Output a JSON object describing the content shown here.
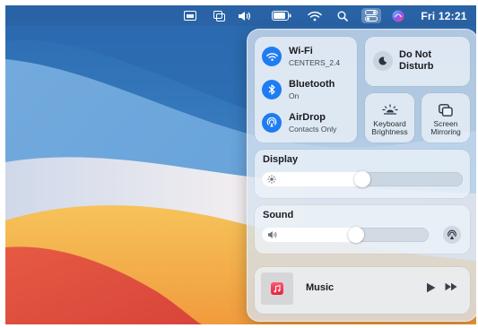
{
  "menubar": {
    "icons": [
      "keyboard-shortcut-icon",
      "mirroring-icon",
      "volume-icon",
      "battery-icon",
      "wifi-icon",
      "search-icon",
      "control-center-icon",
      "siri-icon"
    ],
    "clock": "Fri 12:21"
  },
  "control_center": {
    "network": {
      "wifi": {
        "title": "Wi-Fi",
        "subtitle": "CENTERS_2.4",
        "icon": "wifi-icon",
        "enabled": true
      },
      "bluetooth": {
        "title": "Bluetooth",
        "subtitle": "On",
        "icon": "bluetooth-icon",
        "enabled": true
      },
      "airdrop": {
        "title": "AirDrop",
        "subtitle": "Contacts Only",
        "icon": "airdrop-icon",
        "enabled": true
      }
    },
    "do_not_disturb": {
      "line1": "Do Not",
      "line2": "Disturb",
      "icon": "moon-icon"
    },
    "keyboard_brightness": {
      "line1": "Keyboard",
      "line2": "Brightness",
      "icon": "keyboard-brightness-icon"
    },
    "screen_mirroring": {
      "line1": "Screen",
      "line2": "Mirroring",
      "icon": "screen-mirroring-icon"
    },
    "display": {
      "title": "Display",
      "level": 0.5,
      "icon": "sun-icon"
    },
    "sound": {
      "title": "Sound",
      "level": 0.57,
      "icon": "speaker-icon",
      "airplay_icon": "airplay-audio-icon"
    },
    "now_playing": {
      "title": "Music",
      "play_icon": "play-icon",
      "forward_icon": "fast-forward-icon"
    }
  },
  "colors": {
    "accent": "#1f7cf2",
    "music_red": "#f0364f"
  }
}
